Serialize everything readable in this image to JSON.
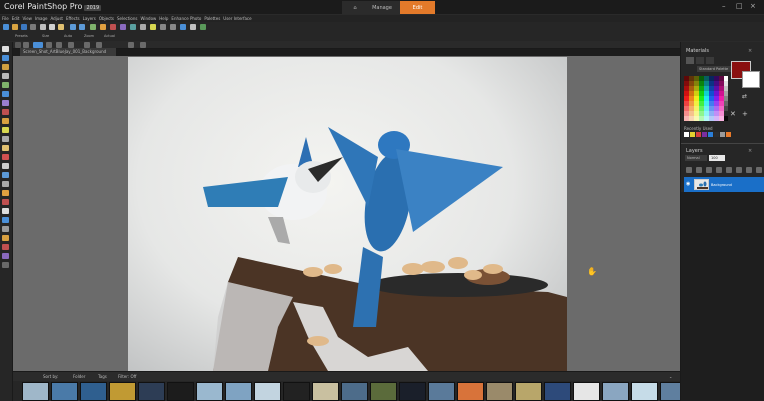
{
  "titlebar": {
    "app_name": "Corel PaintShop Pro",
    "version": "2019",
    "tabs": [
      {
        "label": "⌂",
        "name": "home"
      },
      {
        "label": "Manage",
        "name": "manage"
      },
      {
        "label": "Edit",
        "name": "edit",
        "active": true
      }
    ],
    "controls": [
      "–",
      "□",
      "×"
    ]
  },
  "menubar": {
    "items": [
      "File",
      "Edit",
      "View",
      "Image",
      "Adjust",
      "Effects",
      "Layers",
      "Objects",
      "Selections",
      "Window",
      "Help",
      "Enhance Photo",
      "Palettes",
      "User Interface"
    ]
  },
  "toolbar": {
    "labels": [
      "Presets",
      "Size",
      "Auto",
      "Zoom",
      "Actual"
    ]
  },
  "document": {
    "tab_label": "Screen_Shot_ArtBlueJay_001_Background"
  },
  "canvas": {
    "description_color": "#e9e9e7"
  },
  "filmstrip": {
    "toolbar_text": [
      "Sort by:",
      "Folder",
      "Tags",
      "Filter: Off"
    ],
    "thumbnails": [
      "#9fb7c9",
      "#4a7aa8",
      "#2f5f8f",
      "#c19a33",
      "#2d3d55",
      "#1c1c1c",
      "#9ab8cf",
      "#7fa3c2",
      "#c2d4e0",
      "#222",
      "#c9c0a0",
      "#4d6c8a",
      "#5b6b3b",
      "#1a1f2a",
      "#5a7a9a",
      "#d8733a",
      "#9a8a6a",
      "#b8a66a",
      "#2d4a7a",
      "#e6e6e6",
      "#8aa6c1",
      "#c6dce8",
      "#5f7f9f"
    ]
  },
  "materials": {
    "title": "Materials",
    "dropdown": "Standard Palette",
    "fg_color": "#8a1010",
    "bg_color": "#ffffff",
    "recent_label": "Recently Used",
    "recent_colors": [
      "#ffffff",
      "#e3d230",
      "#d5403d",
      "#7b2ea1",
      "#2b7fd9",
      "#2c2c2c",
      "#9b9b9b",
      "#e87a2a"
    ]
  },
  "layers": {
    "title": "Layers",
    "blend_mode": "Normal",
    "opacity": "100",
    "layer_name": "Background"
  },
  "colors": {
    "accent": "#e37a2a",
    "selection": "#1a6fc8"
  }
}
